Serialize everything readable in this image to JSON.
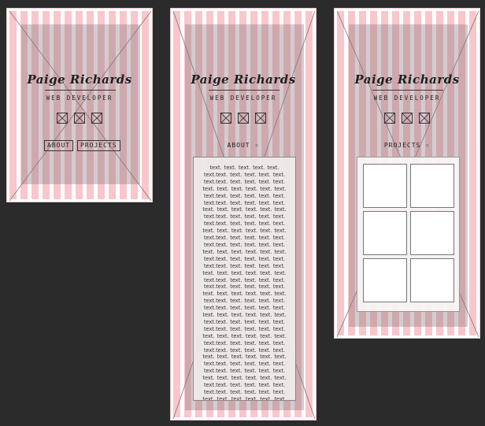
{
  "site": {
    "name": "Paige Richards",
    "role": "WEB DEVELOPER",
    "nav": {
      "about": "ABOUT",
      "projects": "PROJECTS"
    },
    "close_glyph": "×",
    "about_text": "text. text. text. text. text. text.text. text. text. text. text. text.text. text. text. text. text. text. text. text. text. text. text. text.text. text. text. text. text. text.text. text. text. text. text. text. text. text. text. text. text. text.text. text. text. text. text. text.text. text. text. text. text. text. text. text. text. text. text. text.text. text. text. text. text. text.text. text. text. text. text. text. text. text. text. text. text. text.text. text. text. text. text. text.text. text. text. text. text. text. text. text. text. text. text. text.text. text. text. text. text. text.text. text. text. text. text. text. text. text. text. text. text. text.text. text. text. text. text. text.text. text. text. text. text. text. text. text. text. text. text. text.text. text. text. text. text. text.text. text. text. text. text. text. text. text. text. text. text. text.text. text. text. text. text. text.text. text. text. text. text. text. text. text. text. text. text. text.text. text. text. text. text. text.text. text. text. text. text. text. text. text. text. text. text. text.text. text. text. text. text. text.text. text. text. text. text. text. text. text. text. text. text. text.text. text. text. text. text. text.text. text. text. text. text. text. text. text. text. text. text. text.text. text. text. text. text. text. text. text. text. text. text."
  },
  "icons": [
    "placeholder-image-icon",
    "placeholder-image-icon",
    "placeholder-image-icon"
  ],
  "colors": {
    "background": "#2b2b2b",
    "stripe": "#f9c6cb",
    "panel": "#8c787d"
  }
}
